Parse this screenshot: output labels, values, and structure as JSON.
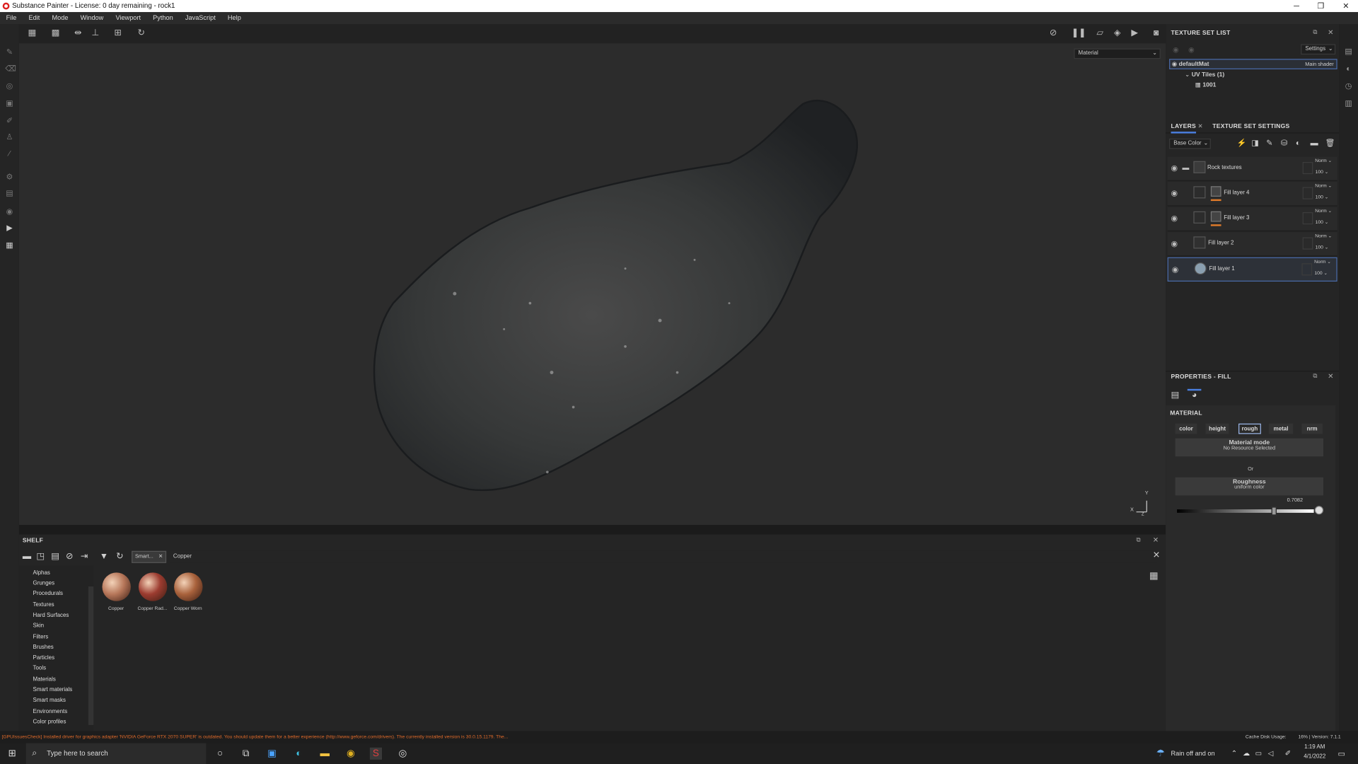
{
  "window": {
    "title": "Substance Painter - License: 0 day remaining - rock1",
    "min": "─",
    "max": "❐",
    "close": "✕"
  },
  "menu": [
    "File",
    "Edit",
    "Mode",
    "Window",
    "Viewport",
    "Python",
    "JavaScript",
    "Help"
  ],
  "viewport": {
    "material_mode": "Material",
    "axis_x": "X",
    "axis_y": "Y",
    "axis_z": "Z"
  },
  "texture_set_list": {
    "title": "TEXTURE SET LIST",
    "settings_label": "Settings",
    "material": "defaultMat",
    "shader": "Main shader",
    "uv_tiles": "UV Tiles (1)",
    "tile": "1001"
  },
  "layers": {
    "tab_layers": "LAYERS",
    "tab_texture_set_settings": "TEXTURE SET SETTINGS",
    "channel": "Base Color",
    "items": [
      {
        "name": "Rock textures",
        "blend": "Norm",
        "opacity": "100"
      },
      {
        "name": "Fill layer 4",
        "blend": "Norm",
        "opacity": "100"
      },
      {
        "name": "Fill layer 3",
        "blend": "Norm",
        "opacity": "100"
      },
      {
        "name": "Fill layer 2",
        "blend": "Norm",
        "opacity": "100"
      },
      {
        "name": "Fill layer 1",
        "blend": "Norm",
        "opacity": "100"
      }
    ]
  },
  "properties": {
    "title": "PROPERTIES - FILL",
    "material_label": "MATERIAL",
    "channels": [
      "color",
      "height",
      "rough",
      "metal",
      "nrm"
    ],
    "active_channel": "rough",
    "material_mode_title": "Material mode",
    "material_mode_value": "No Resource Selected",
    "or_label": "Or",
    "roughness_title": "Roughness",
    "roughness_sub": "uniform color",
    "roughness_value": "0.7082",
    "roughness_fraction": 0.7082
  },
  "shelf": {
    "title": "SHELF",
    "filter_tag": "Smart...",
    "search": "Copper",
    "categories": [
      "Alphas",
      "Grunges",
      "Procedurals",
      "Textures",
      "Hard Surfaces",
      "Skin",
      "Filters",
      "Brushes",
      "Particles",
      "Tools",
      "Materials",
      "Smart materials",
      "Smart masks",
      "Environments",
      "Color profiles"
    ],
    "items": [
      {
        "label": "Copper",
        "color": "#b7775a"
      },
      {
        "label": "Copper Rad...",
        "color": "#9c3c30"
      },
      {
        "label": "Copper Worn",
        "color": "#a9623c"
      }
    ]
  },
  "status": {
    "message": "[GPUIssuesCheck] Installed driver for graphics adapter 'NVIDIA GeForce RTX 2070 SUPER' is outdated. You should update them for a better experience (http://www.geforce.com/drivers). The currently installed version is 30.0.15.1179. The...",
    "cache": "Cache Disk Usage:",
    "version": "16% | Version: 7.1.1",
    "message_color": "#e06a2a"
  },
  "taskbar": {
    "search_placeholder": "Type here to search",
    "weather": "Rain off and on",
    "time": "1:19 AM",
    "date": "4/1/2022"
  }
}
